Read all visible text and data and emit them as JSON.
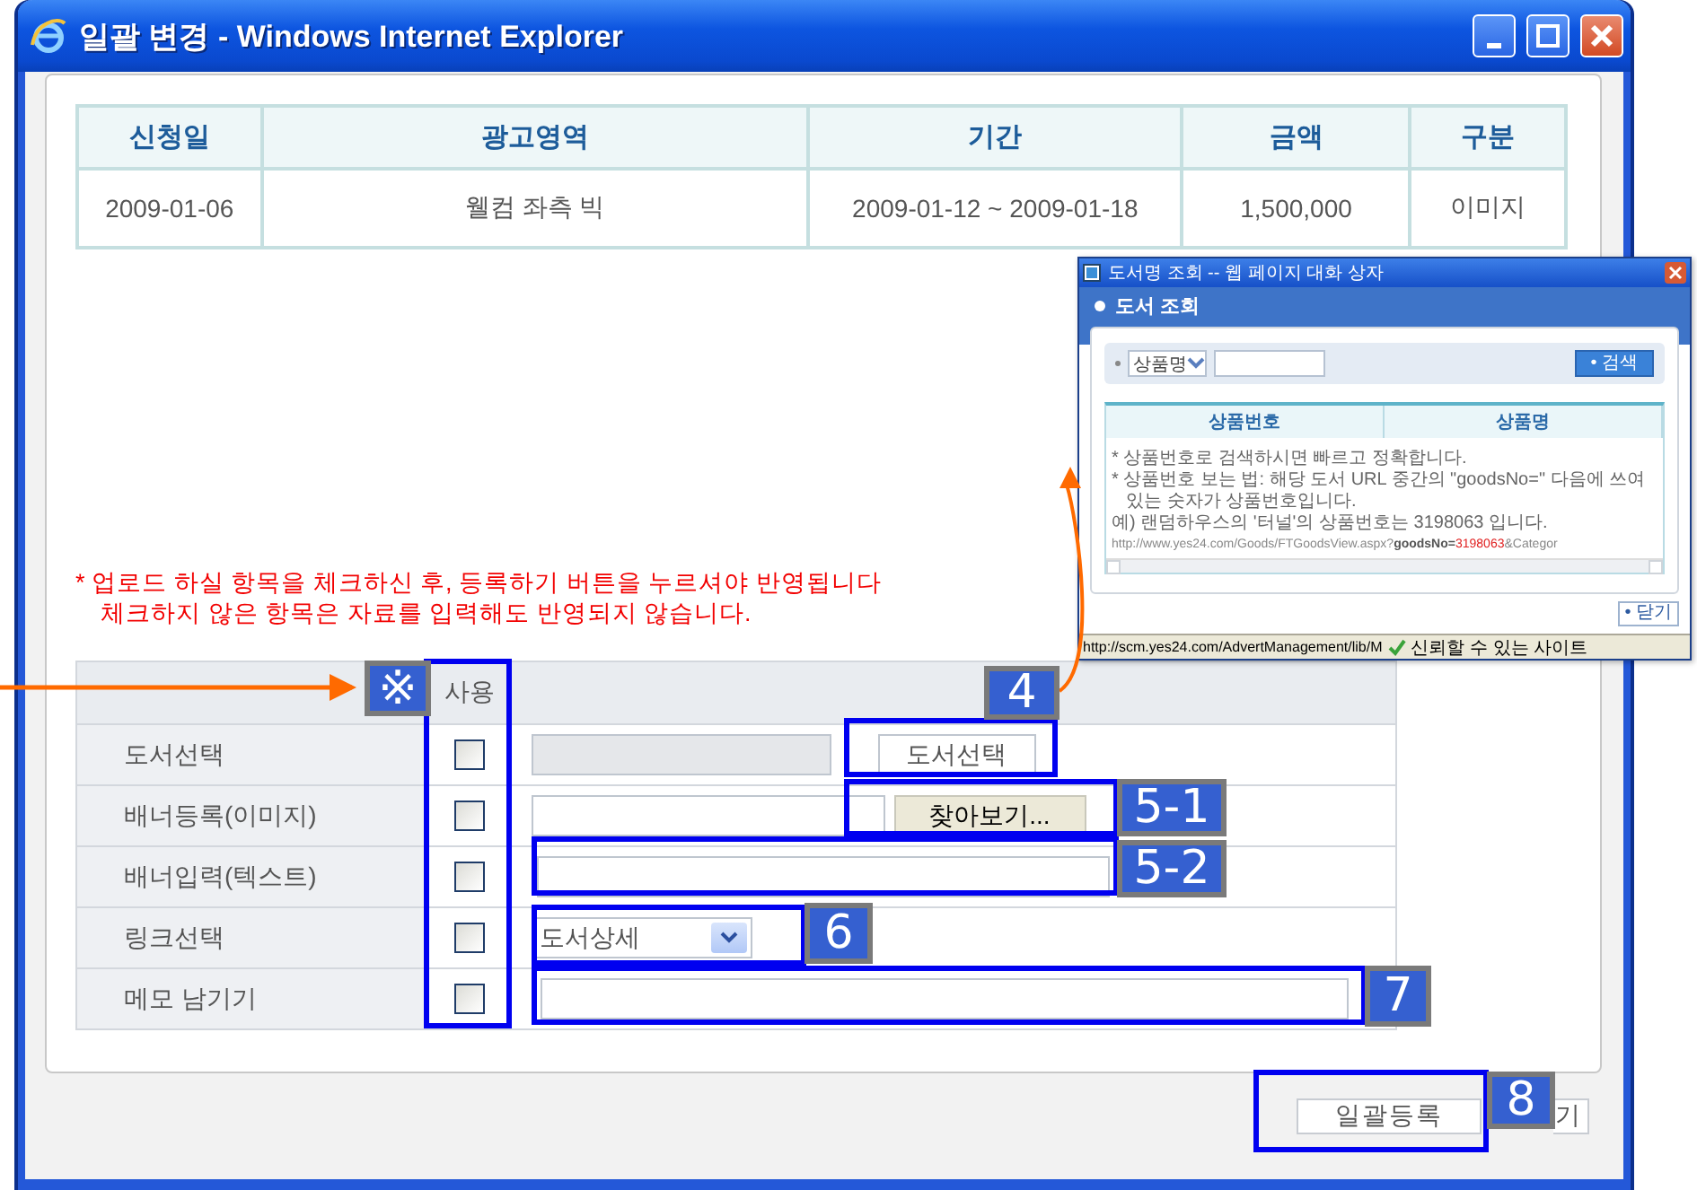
{
  "window": {
    "title": "일괄 변경 - Windows Internet Explorer"
  },
  "ad_table": {
    "columns": [
      "신청일",
      "광고영역",
      "기간",
      "금액",
      "구분"
    ],
    "rows": [
      [
        "2009-01-06",
        "웰컴 좌측 빅",
        "2009-01-12 ~ 2009-01-18",
        "1,500,000",
        "이미지"
      ]
    ]
  },
  "notice": [
    "* 업로드 하실 항목을 체크하신 후, 등록하기 버튼을 누르셔야 반영됩니다",
    "체크하지 않은 항목은 자료를 입력해도 반영되지 않습니다."
  ],
  "form": {
    "use_header": "사용",
    "rows": [
      {
        "label": "도서선택",
        "checked": false,
        "kind": "book",
        "button": "도서선택"
      },
      {
        "label": "배너등록(이미지)",
        "checked": false,
        "kind": "file",
        "button": "찾아보기..."
      },
      {
        "label": "배너입력(텍스트)",
        "checked": false,
        "kind": "text"
      },
      {
        "label": "링크선택",
        "checked": false,
        "kind": "select",
        "value": "도서상세"
      },
      {
        "label": "메모 남기기",
        "checked": false,
        "kind": "memo"
      }
    ]
  },
  "buttons": {
    "register": "일괄등록",
    "close": "기"
  },
  "annotations": [
    "※",
    "4",
    "5-1",
    "5-2",
    "6",
    "7",
    "8"
  ],
  "popup": {
    "title": "도서명 조회 -- 웹 페이지 대화 상자",
    "heading": "도서 조회",
    "search": {
      "field": "상품명",
      "button": "• 검색"
    },
    "columns": [
      "상품번호",
      "상품명"
    ],
    "notes": [
      {
        "kind": "bullet",
        "text": "* 상품번호로 검색하시면 빠르고 정확합니다."
      },
      {
        "kind": "bullet",
        "text": "* 상품번호 보는 법: 해당 도서 URL 중간의 \"goodsNo=\" 다음에 쓰여있는 숫자가 상품번호입니다."
      },
      {
        "kind": "example",
        "text": "예) 랜덤하우스의 '터널'의 상품번호는 3198063 입니다."
      }
    ],
    "url": {
      "base": "http://www.yes24.com/Goods/FTGoodsView.aspx?",
      "key": "goodsNo=",
      "value": "3198063",
      "rest": "&Categor"
    },
    "close": "• 닫기",
    "status": {
      "url": "http://scm.yes24.com/AdvertManagement/lib/M",
      "zone": "신뢰할 수 있는 사이트"
    }
  }
}
